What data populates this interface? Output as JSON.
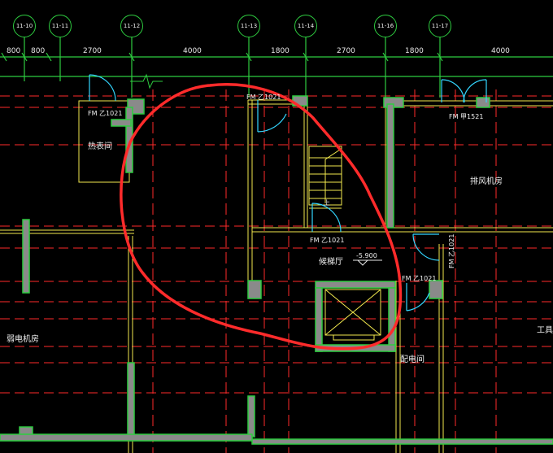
{
  "axes": [
    "11-10",
    "11-11",
    "11-12",
    "11-13",
    "11-14",
    "11-16",
    "11-17"
  ],
  "dimensions": [
    "800",
    "800",
    "2700",
    "4000",
    "1800",
    "2700",
    "1800",
    "4000"
  ],
  "doors": {
    "fm1": "FM 乙1021",
    "fm2": "FM 乙1021",
    "fm3": "FM 甲1521",
    "fm4": "FM 乙1021",
    "fm5": "FM 乙1021",
    "fm6": "FM 乙1021"
  },
  "rooms": {
    "meter": "热表间",
    "exhaust": "排风机房",
    "lobby": "候梯厅",
    "power": "配电间",
    "weak": "弱电机房",
    "tool": "工具"
  },
  "elevation": "-5.900",
  "stair_mark": "上",
  "colors": {
    "background": "#000000",
    "axis_green": "#2ecc40",
    "grid_red": "#ff2a2a",
    "wall_yellow": "#f2e94e",
    "door_cyan": "#33d6ff",
    "highlight_circle": "#ff2b2b"
  }
}
